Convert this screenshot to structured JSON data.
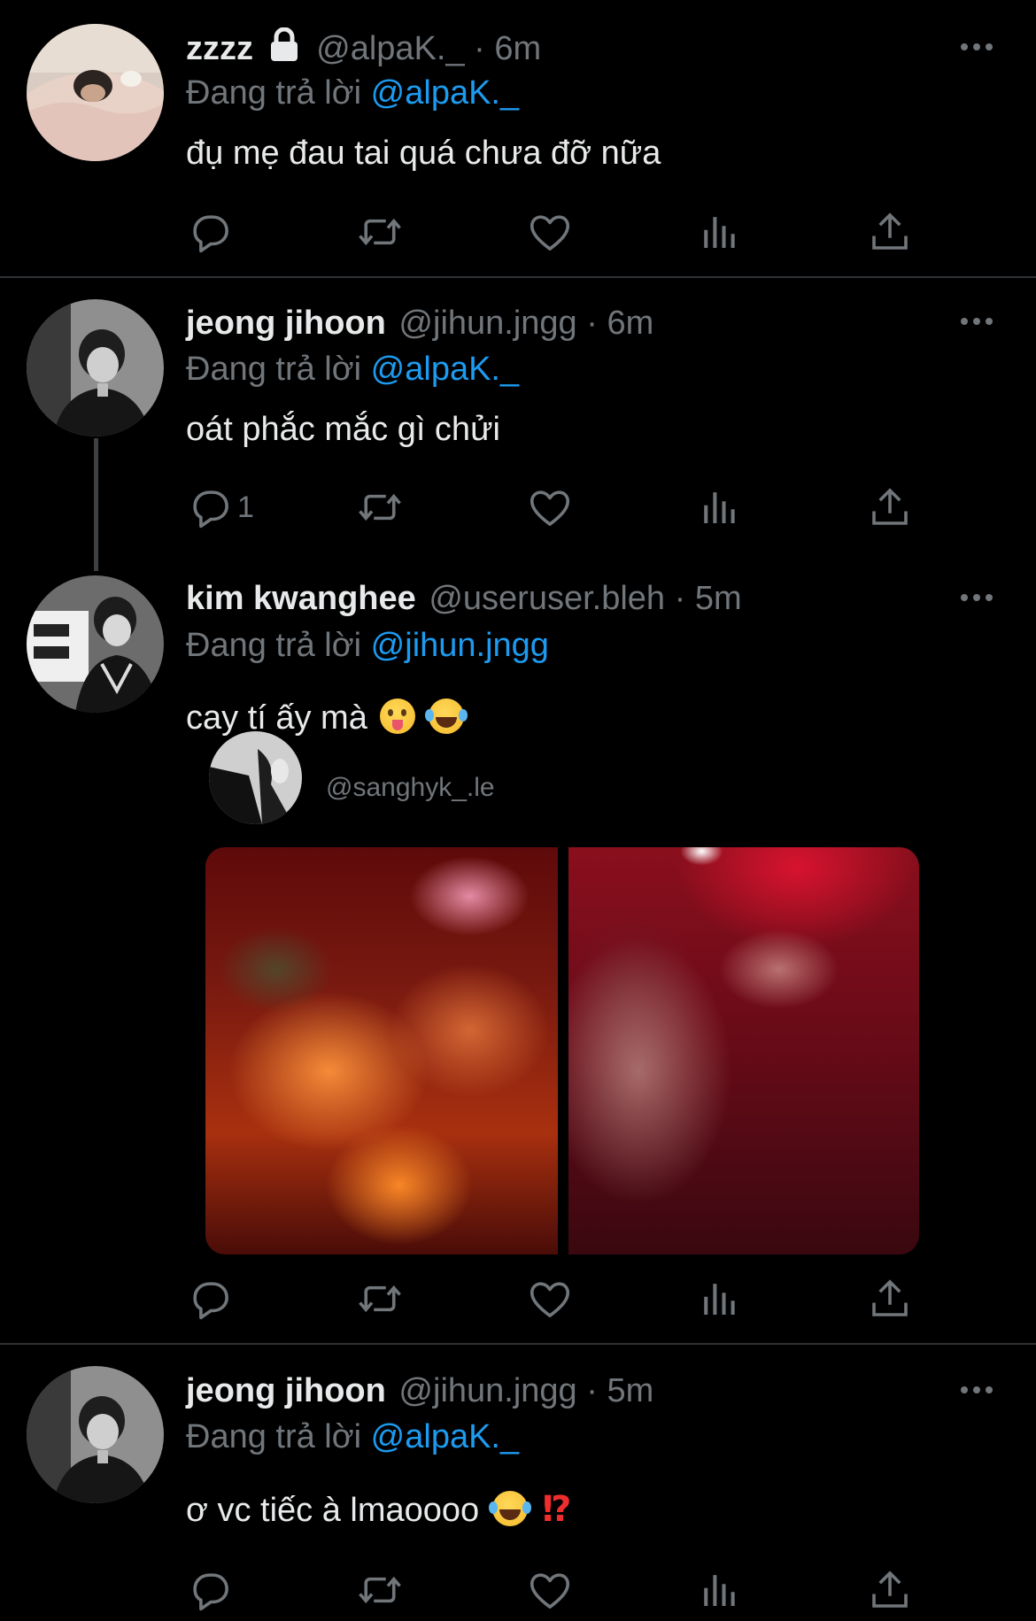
{
  "tweets": [
    {
      "name": "zzzz",
      "locked": true,
      "handle": "@alpaK._",
      "time": "6m",
      "reply_prefix": "Đang trả lời",
      "reply_to": "@alpaK._",
      "text": "đụ mẹ đau tai quá chưa đỡ nữa"
    },
    {
      "name": "jeong jihoon",
      "handle": "@jihun.jngg",
      "time": "6m",
      "reply_prefix": "Đang trả lời",
      "reply_to": "@alpaK._",
      "text": "oát phắc mắc gì chửi",
      "reply_count": "1"
    },
    {
      "name": "kim kwanghee",
      "handle": "@useruser.bleh",
      "time": "5m",
      "reply_prefix": "Đang trả lời",
      "reply_to": "@jihun.jngg",
      "text": "cay tí ấy mà",
      "emojis": [
        "face-with-tongue",
        "face-with-tears-of-joy"
      ],
      "quote": {
        "handle": "@sanghyk_.le"
      }
    },
    {
      "name": "jeong jihoon",
      "handle": "@jihun.jngg",
      "time": "5m",
      "reply_prefix": "Đang trả lời",
      "reply_to": "@alpaK._",
      "text": "ơ vc tiếc à lmaoooo",
      "emojis": [
        "face-with-tears-of-joy",
        "exclamation-question-mark"
      ],
      "bang": "⁉"
    }
  ],
  "sep": " · ",
  "colors": {
    "background": "#000000",
    "link": "#1d9bf0",
    "muted": "#71767b",
    "text": "#e7e9ea"
  }
}
